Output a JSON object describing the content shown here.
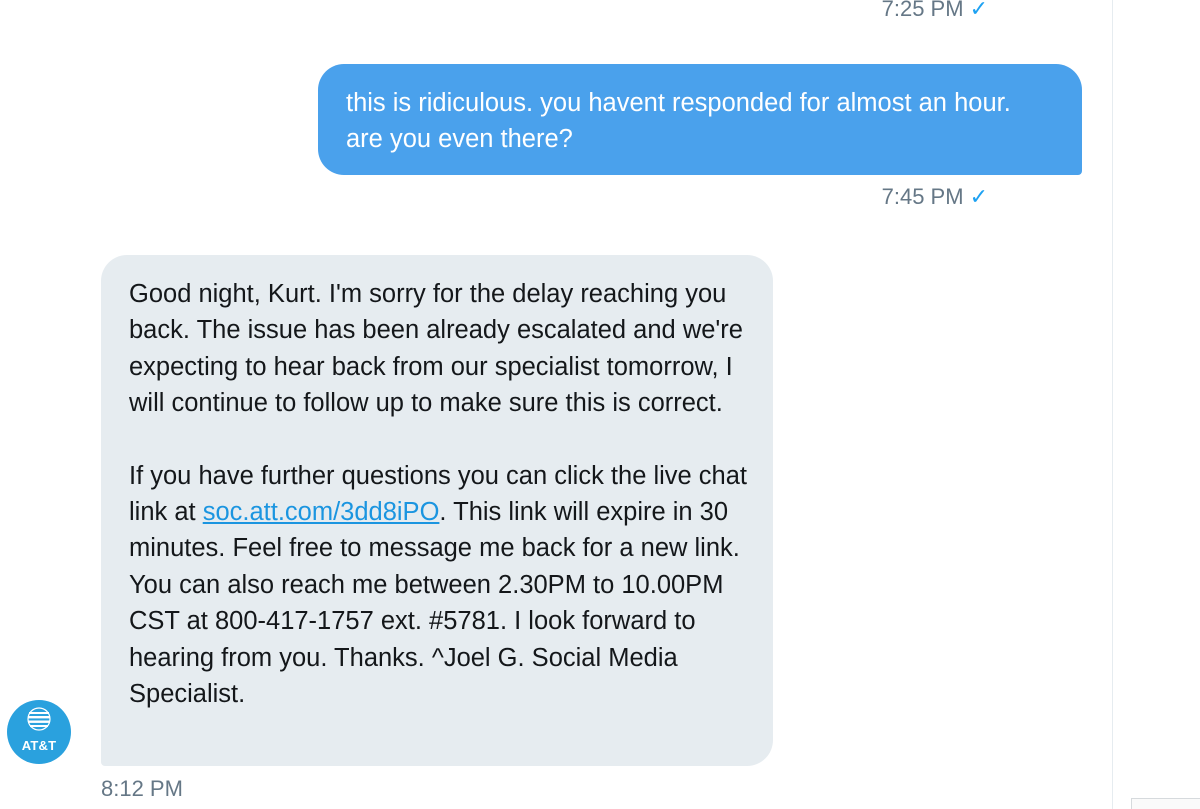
{
  "conversation": {
    "earlier_message": {
      "time": "7:25 PM",
      "read_icon": "checkmark-icon"
    },
    "sent_message": {
      "text": "this is ridiculous. you havent responded for almost an hour. are you even there?",
      "time": "7:45 PM",
      "read_icon": "checkmark-icon",
      "bubble_color": "#4aa1ec"
    },
    "received_message": {
      "paragraph1": "Good night, Kurt. I'm sorry for the delay reaching you back. The issue has been already escalated and we're expecting to hear back from our specialist tomorrow, I will continue to follow up to make sure this is correct.",
      "paragraph2_before_link": "If you have further questions you can click the live chat link at ",
      "link_text": "soc.att.com/3dd8iPO",
      "paragraph2_after_link": ". This link will expire in 30 minutes. Feel free to message me back for a new link. You can also reach me between 2.30PM to 10.00PM CST at 800-417-1757 ext. #5781. I look forward to hearing from you. Thanks. ^Joel G. Social Media Specialist.",
      "time": "8:12 PM",
      "bubble_color": "#e6ecf0"
    },
    "sender_avatar": {
      "label": "AT&T",
      "icon": "att-globe-icon",
      "color": "#2aa1de"
    }
  }
}
